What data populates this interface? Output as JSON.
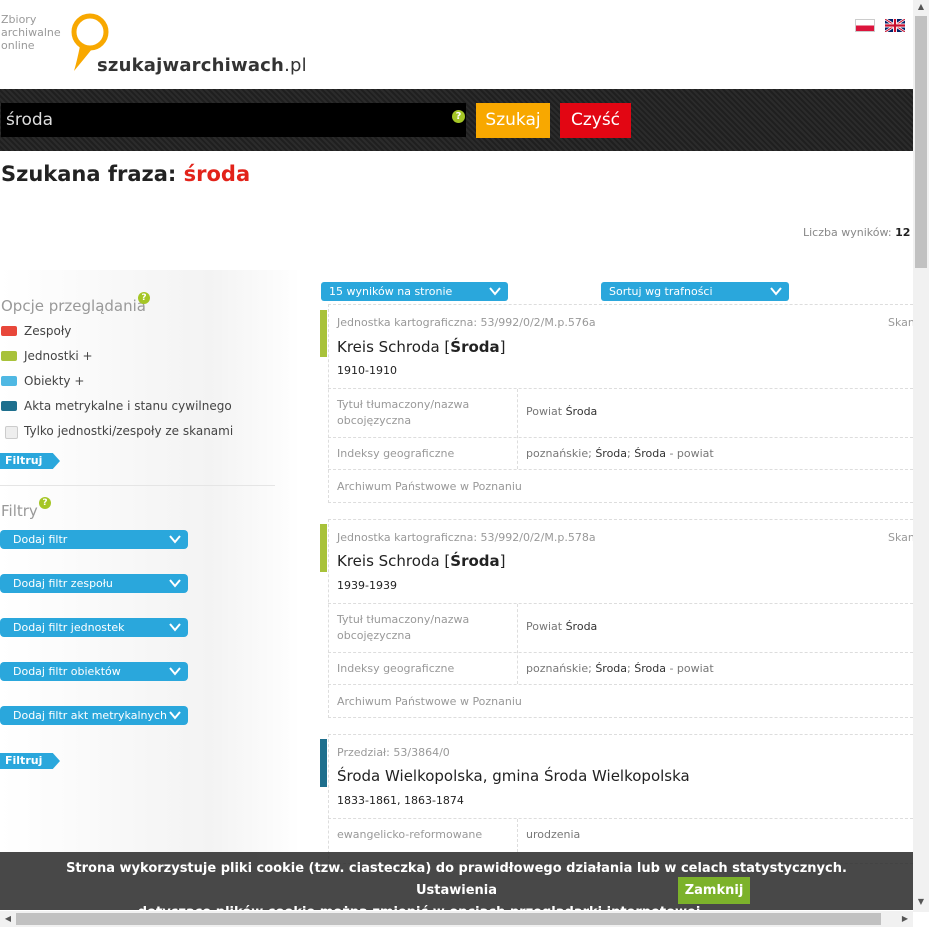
{
  "header": {
    "tagline": [
      "Zbiory",
      "archiwalne",
      "online"
    ],
    "logo_text_bold": "szukajwarchiwach",
    "logo_text_tld": ".pl",
    "languages": [
      "pl-flag",
      "en-flag"
    ]
  },
  "search": {
    "value": "środa",
    "help": "?",
    "search_label": "Szukaj",
    "clear_label": "Czyść"
  },
  "title": {
    "prefix": "Szukana fraza: ",
    "phrase": "środa"
  },
  "results_count": {
    "label": "Liczba wyników: ",
    "value": "12"
  },
  "view_options": {
    "title": "Opcje przeglądania",
    "help": "?",
    "items": [
      {
        "label": "Zespoły",
        "color": "#e8473a"
      },
      {
        "label": "Jednostki +",
        "color": "#a8c23a"
      },
      {
        "label": "Obiekty +",
        "color": "#4fb8e3"
      },
      {
        "label": "Akta metrykalne i stanu cywilnego",
        "color": "#1e6f8d"
      }
    ],
    "scans_only": "Tylko jednostki/zespoły ze skanami",
    "filter_button": "Filtruj"
  },
  "filters": {
    "title": "Filtry",
    "help": "?",
    "dropdowns": [
      "Dodaj filtr",
      "Dodaj filtr zespołu",
      "Dodaj filtr jednostek",
      "Dodaj filtr obiektów",
      "Dodaj filtr akt metrykalnych"
    ],
    "filter_button": "Filtruj"
  },
  "controls": {
    "per_page": "15 wyników na stronie",
    "sort": "Sortuj wg trafności"
  },
  "results": [
    {
      "meta": "Jednostka kartograficzna: 53/992/0/2/M.p.576a",
      "scan": "Skan",
      "title_before": "Kreis Schroda [",
      "title_bold": "Środa",
      "title_after": "]",
      "dates": "1910-1910",
      "row1_label": "Tytuł tłumaczony/nazwa obcojęzyczna",
      "row1_value_before": "Powiat ",
      "row1_value_bold": "Środa",
      "row2_label": "Indeksy geograficzne",
      "row2_value_a": "poznańskie; ",
      "row2_value_b": "Środa",
      "row2_value_c": "; ",
      "row2_value_d": "Środa",
      "row2_value_e": " - powiat",
      "archive": "Archiwum Państwowe w Poznaniu",
      "color": "#a8c23a"
    },
    {
      "meta": "Jednostka kartograficzna: 53/992/0/2/M.p.578a",
      "scan": "Skan",
      "title_before": "Kreis Schroda [",
      "title_bold": "Środa",
      "title_after": "]",
      "dates": "1939-1939",
      "row1_label": "Tytuł tłumaczony/nazwa obcojęzyczna",
      "row1_value_before": "Powiat ",
      "row1_value_bold": "Środa",
      "row2_label": "Indeksy geograficzne",
      "row2_value_a": "poznańskie; ",
      "row2_value_b": "Środa",
      "row2_value_c": "; ",
      "row2_value_d": "Środa",
      "row2_value_e": " - powiat",
      "archive": "Archiwum Państwowe w Poznaniu",
      "color": "#a8c23a"
    },
    {
      "meta": "Przedział: 53/3864/0",
      "title_a": "Środa",
      "title_b": " Wielkopolska, gmina ",
      "title_c": "Środa",
      "title_d": " Wielkopolska",
      "dates": "1833-1861, 1863-1874",
      "row1_label": "ewangelicko-reformowane",
      "row1_value": "urodzenia",
      "color": "#1e6f8d"
    }
  ],
  "cookie": {
    "line1": "Strona wykorzystuje pliki cookie (tzw. ciasteczka) do prawidłowego działania lub w celach statystycznych. Ustawienia",
    "line2": "dotyczące plików cookie można zmienić w opcjach przeglądarki internetowej.",
    "button": "Zamknij"
  }
}
